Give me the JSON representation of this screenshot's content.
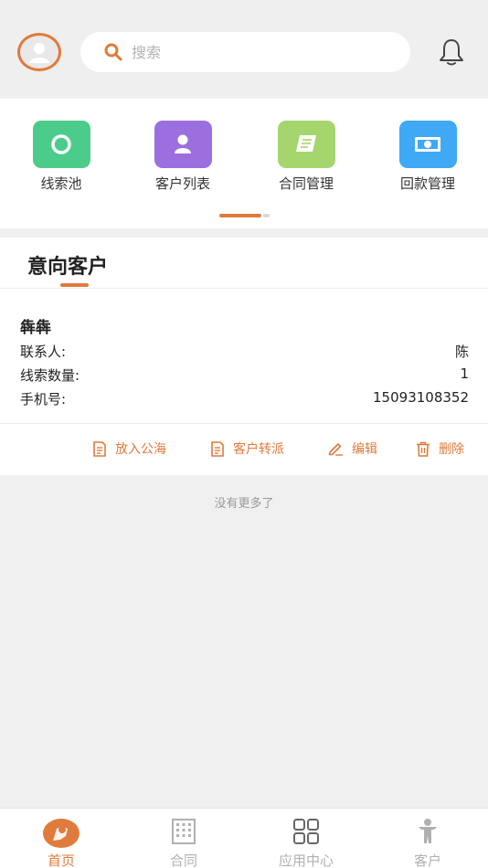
{
  "header": {
    "search_placeholder": "搜索",
    "accent_color": "#e07b3c"
  },
  "quick_menu": {
    "items": [
      {
        "label": "线索池",
        "icon": "circle-icon",
        "color": "#4ccc8a"
      },
      {
        "label": "客户列表",
        "icon": "person-icon",
        "color": "#9b6fe0"
      },
      {
        "label": "合同管理",
        "icon": "book-icon",
        "color": "#a5d66e"
      },
      {
        "label": "回款管理",
        "icon": "banknote-icon",
        "color": "#3fa9f5"
      }
    ]
  },
  "section": {
    "title": "意向客户"
  },
  "customer": {
    "name": "犇犇",
    "contact_label": "联系人:",
    "contact_value": "陈",
    "leads_label": "线索数量:",
    "leads_value": "1",
    "phone_label": "手机号:",
    "phone_value": "15093108352"
  },
  "actions": {
    "to_pool": "放入公海",
    "transfer": "客户转派",
    "edit": "编辑",
    "delete": "删除"
  },
  "list_end_text": "没有更多了",
  "tabbar": {
    "items": [
      {
        "label": "首页",
        "icon": "home-icon",
        "active": true
      },
      {
        "label": "合同",
        "icon": "building-icon",
        "active": false
      },
      {
        "label": "应用中心",
        "icon": "apps-icon",
        "active": false
      },
      {
        "label": "客户",
        "icon": "customer-icon",
        "active": false
      }
    ]
  }
}
